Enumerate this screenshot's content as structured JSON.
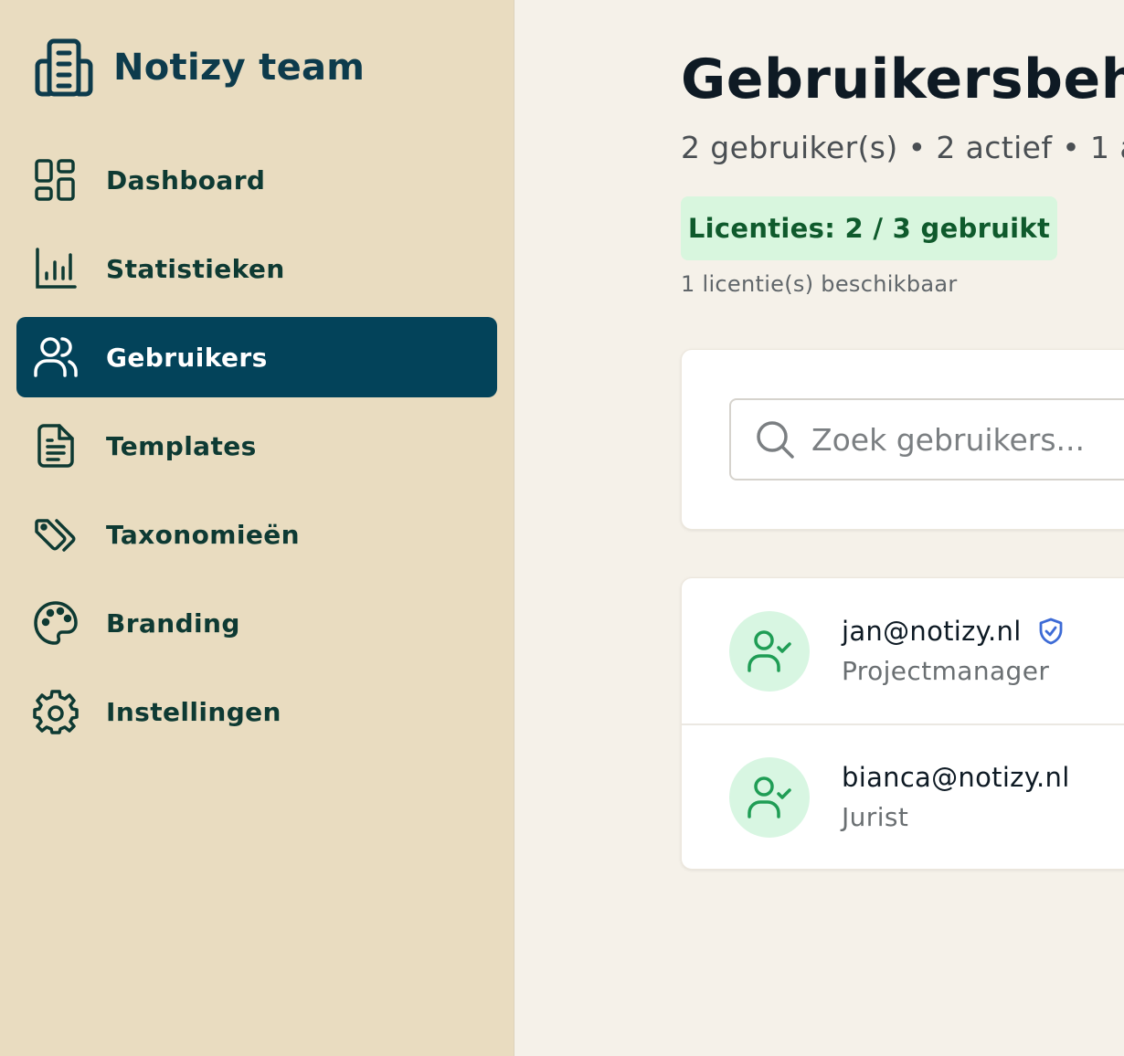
{
  "sidebar": {
    "brand": {
      "title": "Notizy team",
      "icon": "building-icon"
    },
    "items": [
      {
        "label": "Dashboard",
        "icon": "dashboard-icon",
        "active": false
      },
      {
        "label": "Statistieken",
        "icon": "bar-chart-icon",
        "active": false
      },
      {
        "label": "Gebruikers",
        "icon": "users-icon",
        "active": true
      },
      {
        "label": "Templates",
        "icon": "document-icon",
        "active": false
      },
      {
        "label": "Taxonomieën",
        "icon": "tags-icon",
        "active": false
      },
      {
        "label": "Branding",
        "icon": "palette-icon",
        "active": false
      },
      {
        "label": "Instellingen",
        "icon": "gear-icon",
        "active": false
      }
    ]
  },
  "main": {
    "title": "Gebruikersbeheer",
    "summary": "2 gebruiker(s) • 2 actief • 1 a",
    "license": {
      "badge": "Licenties: 2 / 3 gebruikt",
      "available": "1 licentie(s) beschikbaar"
    },
    "search": {
      "placeholder": "Zoek gebruikers..."
    },
    "users": [
      {
        "email": "jan@notizy.nl",
        "role": "Projectmanager",
        "admin_badge": true
      },
      {
        "email": "bianca@notizy.nl",
        "role": "Jurist",
        "admin_badge": false
      }
    ]
  },
  "colors": {
    "sidebar_bg": "#e9dcc0",
    "active_bg": "#03435a",
    "page_bg": "#f5f1e9",
    "badge_bg": "#d8f6de",
    "badge_text": "#0f5a2c",
    "avatar_bg": "#d8f6e2",
    "avatar_icon": "#1f9d55",
    "shield": "#3d6bd6"
  }
}
